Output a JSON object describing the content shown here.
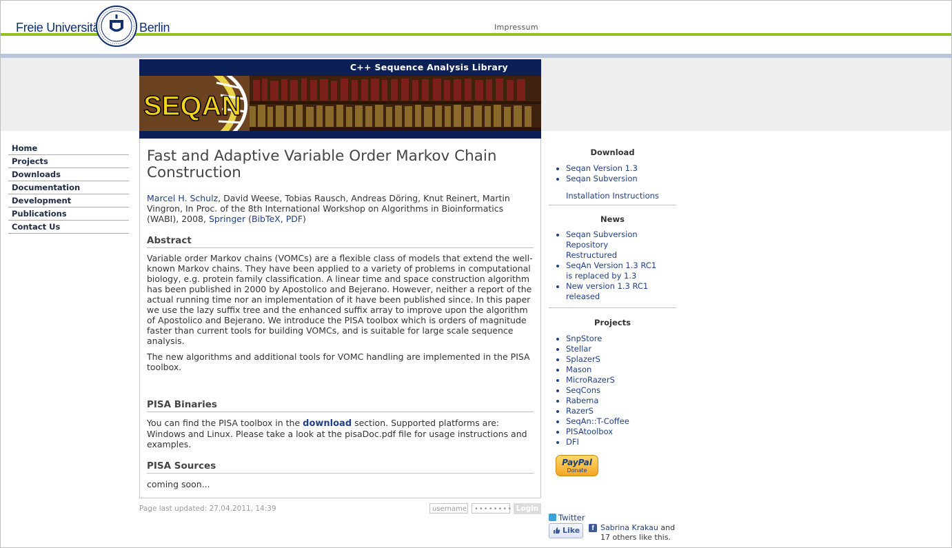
{
  "header": {
    "logo_left": "Freie Universität",
    "logo_right": "Berlin",
    "impressum": "Impressum"
  },
  "banner": {
    "title": "C++ Sequence Analysis Library",
    "logo_text": "SEQAN"
  },
  "leftnav": {
    "items": [
      {
        "label": "Home"
      },
      {
        "label": "Projects"
      },
      {
        "label": "Downloads"
      },
      {
        "label": "Documentation"
      },
      {
        "label": "Development"
      },
      {
        "label": "Publications"
      },
      {
        "label": "Contact Us"
      }
    ]
  },
  "article": {
    "title": "Fast and Adaptive Variable Order Markov Chain Construction",
    "first_author": "Marcel H. Schulz",
    "authors_rest": ", David Weese, Tobias Rausch, Andreas Döring, Knut Reinert, Martin Vingron, In Proc. of the 8th International Workshop on Algorithms in Bioinformatics (WABI), 2008, ",
    "publisher_link": "Springer",
    "open_paren": " (",
    "bibtex_link": "BibTeX",
    "comma": ", ",
    "pdf_link": "PDF",
    "close_paren": ")",
    "abstract_heading": "Abstract",
    "abstract_p1": "Variable order Markov chains (VOMCs) are a flexible class of models that extend the well-known Markov chains. They have been applied to a variety of problems in computational biology, e.g. protein family classification. A linear time and space construction algorithm has been published in 2000 by Apostolico and Bejerano. However, neither a report of the actual running time nor an implementation of it have been published since. In this paper we use the lazy suffix tree and the enhanced suffix array to improve upon the algorithm of Apostolico and Bejerano. We introduce the PISA toolbox which is orders of magnitude faster than current tools for building VOMCs, and is suitable for large scale sequence analysis.",
    "abstract_p2": "The new algorithms and additional tools for VOMC handling are implemented in the PISA toolbox.",
    "binaries_heading": "PISA Binaries",
    "binaries_pre": "You can find the PISA toolbox in the ",
    "binaries_link": "download",
    "binaries_post": " section. Supported platforms are: Windows and Linux. Please take a look at the pisaDoc.pdf file for usage instructions and examples.",
    "sources_heading": "PISA Sources",
    "sources_text": "coming soon..."
  },
  "footer": {
    "updated": "Page last updated: 27.04.2011, 14:39",
    "username_placeholder": "username",
    "password_placeholder": "••••••••",
    "login_label": "Login"
  },
  "sidebar": {
    "download": {
      "title": "Download",
      "items": [
        {
          "label": "Seqan Version 1.3"
        },
        {
          "label": "Seqan Subversion"
        }
      ],
      "install": "Installation Instructions"
    },
    "news": {
      "title": "News",
      "items": [
        {
          "label": "Seqan Subversion Repository Restructured"
        },
        {
          "label": "SeqAn Version 1.3 RC1 is replaced by 1.3"
        },
        {
          "label": "New version 1.3 RC1 released"
        }
      ]
    },
    "projects": {
      "title": "Projects",
      "items": [
        {
          "label": "SnpStore"
        },
        {
          "label": "Stellar"
        },
        {
          "label": "SplazerS"
        },
        {
          "label": "Mason"
        },
        {
          "label": "MicroRazerS"
        },
        {
          "label": "SeqCons"
        },
        {
          "label": "Rabema"
        },
        {
          "label": "RazerS"
        },
        {
          "label": "SeqAn::T-Coffee"
        },
        {
          "label": "PISAtoolbox"
        },
        {
          "label": "DFI"
        }
      ]
    },
    "paypal": {
      "brand": "PayPal",
      "label": "Donate"
    },
    "twitter": "Twitter",
    "like_label": "Like",
    "fb_name": "Sabrina Krakau",
    "fb_and": " and",
    "fb_rest": "17 others like this."
  },
  "colors": {
    "accent_green": "#93c11c",
    "accent_blue": "#b9c5dc",
    "link": "#1f3f86",
    "banner_bg": "#0b2156"
  }
}
